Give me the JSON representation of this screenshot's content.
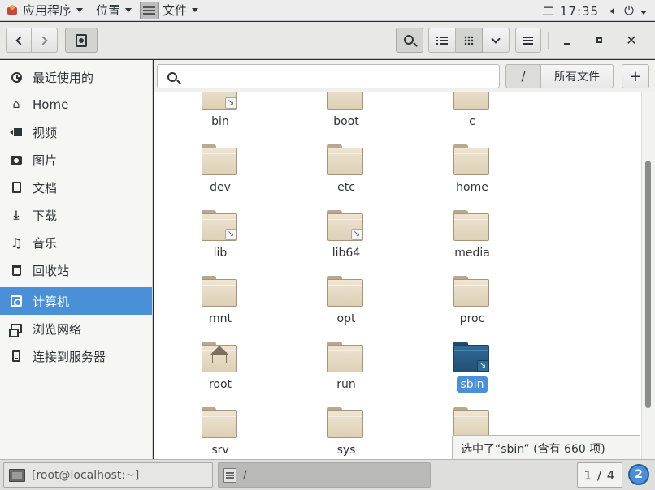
{
  "topbar": {
    "apps_label": "应用程序",
    "places_label": "位置",
    "app_label": "文件",
    "clock": "二 17:35"
  },
  "headerbar": {
    "view_list": "list-icon",
    "view_grid": "grid-icon"
  },
  "search": {
    "placeholder": ""
  },
  "pathbar": {
    "root_label": "/",
    "filter_label": "所有文件",
    "add_label": "+"
  },
  "sidebar": {
    "items": [
      {
        "label": "最近使用的",
        "icon": "clock-icon"
      },
      {
        "label": "Home",
        "icon": "home-icon"
      },
      {
        "label": "视频",
        "icon": "video-icon"
      },
      {
        "label": "图片",
        "icon": "camera-icon"
      },
      {
        "label": "文档",
        "icon": "document-icon"
      },
      {
        "label": "下载",
        "icon": "download-icon"
      },
      {
        "label": "音乐",
        "icon": "music-icon"
      },
      {
        "label": "回收站",
        "icon": "trash-icon"
      },
      {
        "label": "计算机",
        "icon": "computer-icon",
        "active": true
      },
      {
        "label": "浏览网络",
        "icon": "network-icon"
      },
      {
        "label": "连接到服务器",
        "icon": "server-icon"
      }
    ]
  },
  "files": [
    {
      "name": "bin",
      "link": true
    },
    {
      "name": "boot"
    },
    {
      "name": "c"
    },
    {
      "name": "dev"
    },
    {
      "name": "etc"
    },
    {
      "name": "home"
    },
    {
      "name": "lib",
      "link": true
    },
    {
      "name": "lib64",
      "link": true
    },
    {
      "name": "media"
    },
    {
      "name": "mnt"
    },
    {
      "name": "opt"
    },
    {
      "name": "proc"
    },
    {
      "name": "root",
      "home": true
    },
    {
      "name": "run"
    },
    {
      "name": "sbin",
      "link": true,
      "selected": true
    },
    {
      "name": "srv"
    },
    {
      "name": "sys"
    },
    {
      "name": ""
    }
  ],
  "status": {
    "selection_text": "选中了“sbin” (含有 660 项)"
  },
  "taskbar": {
    "terminal_label": "[root@localhost:~]",
    "files_label": "/",
    "workspace": "1 / 4",
    "notifications": "2"
  }
}
